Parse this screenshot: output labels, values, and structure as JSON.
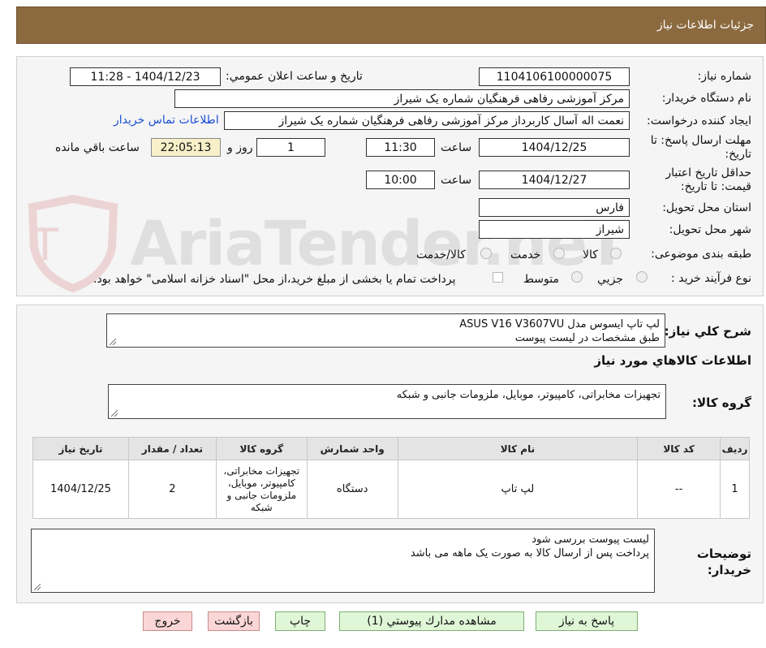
{
  "header": {
    "title": "جزئیات اطلاعات نیاز"
  },
  "form": {
    "need_number": {
      "label": "شماره نیاز:",
      "value": "1104106100000075"
    },
    "announce_datetime": {
      "label": "تاریخ و ساعت اعلان عمومي:",
      "value": "1404/12/23 - 11:28"
    },
    "buyer_org": {
      "label": "نام دستگاه خریدار:",
      "value": "مرکز آموزشی رفاهی فرهنگیان شماره یک شیراز"
    },
    "requester": {
      "label": "ایجاد کننده درخواست:",
      "value": "نعمت اله آسال کاربرداز مرکز آموزشی رفاهی فرهنگیان شماره یک شیراز",
      "contact_link": "اطلاعات تماس خریدار"
    },
    "reply_deadline": {
      "label": "مهلت ارسال پاسخ: تا تاریخ:",
      "date": "1404/12/25",
      "time_label": "ساعت",
      "time": "11:30",
      "days": "1",
      "days_label": "روز و",
      "remaining": "22:05:13",
      "remaining_label": "ساعت باقي مانده"
    },
    "price_validity": {
      "label": "حداقل تاریخ اعتبار قیمت: تا تاریخ:",
      "date": "1404/12/27",
      "time_label": "ساعت",
      "time": "10:00"
    },
    "province": {
      "label": "استان محل تحویل:",
      "value": "فارس"
    },
    "city": {
      "label": "شهر محل تحویل:",
      "value": "شیراز"
    },
    "category": {
      "label": "طبقه بندی موضوعی:",
      "options": [
        "کالا",
        "خدمت",
        "کالا/خدمت"
      ]
    },
    "process_type": {
      "label": "نوع فرآیند خرید :",
      "options": [
        "جزیي",
        "متوسط"
      ],
      "note": "پرداخت تمام یا بخشی از مبلغ خرید،از محل \"اسناد خزانه اسلامی\" خواهد بود."
    }
  },
  "description": {
    "label": "شرح كلي نياز:",
    "line1": "لپ تاپ ایسوس مدل ASUS V16 V3607VU",
    "line2": "طبق مشخصات در لیست پیوست"
  },
  "goods_section": {
    "title": "اطلاعات كالاهاي مورد نياز",
    "group_label": "گروه كالا:",
    "group_value": "تجهیزات مخابراتی، کامپیوتر، موبایل، ملزومات جانبی و شبکه"
  },
  "table": {
    "headers": [
      "ردیف",
      "کد کالا",
      "نام کالا",
      "واحد شمارش",
      "گروه کالا",
      "تعداد / مقدار",
      "تاریخ نیاز"
    ],
    "rows": [
      {
        "row": "1",
        "code": "--",
        "name": "لپ تاپ",
        "unit": "دستگاه",
        "group": "تجهیزات مخابراتی، کامپیوتر، موبایل، ملزومات جانبی و شبکه",
        "qty": "2",
        "date": "1404/12/25"
      }
    ]
  },
  "buyer_notes": {
    "label": "توضیحات خریدار:",
    "line1": "لیست پیوست بررسی شود",
    "line2": "پرداخت پس از ارسال کالا به صورت یک ماهه می باشد"
  },
  "buttons": {
    "reply": "پاسخ به نياز",
    "attachments": "مشاهده مدارك پيوستي (1)",
    "print": "چاپ",
    "back": "بازگشت",
    "exit": "خروج"
  },
  "watermark": {
    "text": "AriaTender.neT"
  },
  "colors": {
    "header_bg": "#8c6a3f",
    "link": "#1a4fd6",
    "green_button": "#dff7d7",
    "pink_button": "#fbd6d6"
  }
}
